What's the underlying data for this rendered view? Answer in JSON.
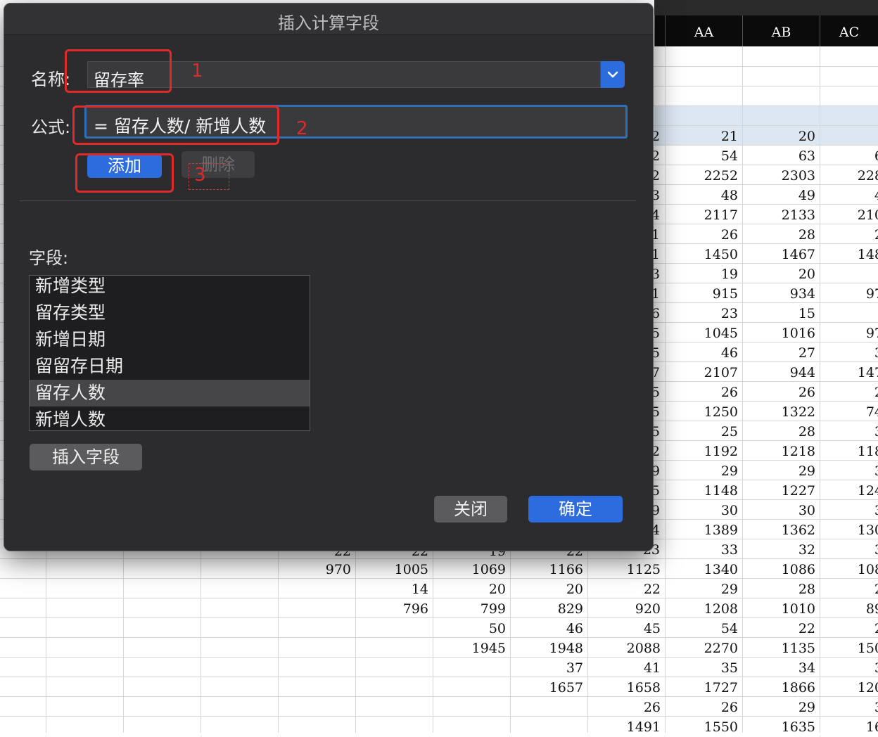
{
  "spreadsheet": {
    "column_headers": [
      "AA",
      "AB",
      "AC"
    ],
    "top_values": {
      "c1": "2",
      "c2": "21",
      "c3": "20"
    },
    "right_rows": [
      [
        "2",
        "54",
        "63",
        "6"
      ],
      [
        "2",
        "2252",
        "2303",
        "228"
      ],
      [
        "3",
        "48",
        "49",
        "4"
      ],
      [
        "4",
        "2117",
        "2133",
        "210"
      ],
      [
        "1",
        "26",
        "28",
        "2"
      ],
      [
        "1",
        "1450",
        "1467",
        "148"
      ],
      [
        "3",
        "19",
        "20",
        ""
      ],
      [
        "1",
        "915",
        "934",
        "97"
      ],
      [
        "6",
        "23",
        "15",
        ""
      ],
      [
        "5",
        "1045",
        "1016",
        "97"
      ],
      [
        "5",
        "46",
        "27",
        "3"
      ],
      [
        "7",
        "2107",
        "944",
        "147"
      ],
      [
        "5",
        "26",
        "26",
        "2"
      ],
      [
        "5",
        "1250",
        "1322",
        "74"
      ],
      [
        "5",
        "25",
        "28",
        "3"
      ],
      [
        "2",
        "1192",
        "1218",
        "118"
      ],
      [
        "9",
        "29",
        "29",
        "3"
      ],
      [
        "5",
        "1148",
        "1227",
        "124"
      ],
      [
        "9",
        "30",
        "30",
        "3"
      ],
      [
        "4",
        "1389",
        "1362",
        "130"
      ],
      [
        "23",
        "33",
        "32",
        "3"
      ]
    ],
    "partial_row": [
      "22",
      "22",
      "19",
      "22"
    ],
    "bottom_rows": [
      [
        "970",
        "1005",
        "1069",
        "1166",
        "1125",
        "1340",
        "1086",
        "108"
      ],
      [
        "",
        "14",
        "20",
        "20",
        "22",
        "29",
        "28",
        "2"
      ],
      [
        "",
        "796",
        "799",
        "829",
        "920",
        "1208",
        "1010",
        "89"
      ],
      [
        "",
        "",
        "50",
        "46",
        "45",
        "54",
        "22",
        "2"
      ],
      [
        "",
        "",
        "1945",
        "1948",
        "2088",
        "2270",
        "1135",
        "150"
      ],
      [
        "",
        "",
        "",
        "37",
        "41",
        "35",
        "34",
        "3"
      ],
      [
        "",
        "",
        "",
        "1657",
        "1658",
        "1727",
        "1866",
        "120"
      ],
      [
        "",
        "",
        "",
        "",
        "26",
        "26",
        "29",
        "3"
      ],
      [
        "",
        "",
        "",
        "",
        "1491",
        "1550",
        "1635",
        "16"
      ]
    ]
  },
  "dialog": {
    "title": "插入计算字段",
    "name_label": "名称:",
    "name_value": "留存率",
    "formula_label": "公式:",
    "formula_value": "= 留存人数/ 新增人数",
    "add_label": "添加",
    "delete_label": "删除",
    "fields_label": "字段:",
    "fields": [
      "新增类型",
      "留存类型",
      "新增日期",
      "留留存日期",
      "留存人数",
      "新增人数"
    ],
    "selected_field": "留存人数",
    "insert_field_label": "插入字段",
    "close_label": "关闭",
    "ok_label": "确定",
    "accent_color": "#2d6cdf"
  },
  "annotations": {
    "step1": "1",
    "step2": "2",
    "step3": "3",
    "color": "#e02a2a"
  }
}
